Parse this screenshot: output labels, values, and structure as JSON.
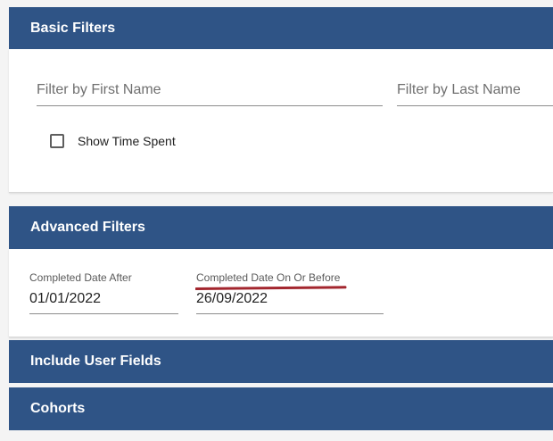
{
  "basic_filters": {
    "title": "Basic Filters",
    "first_name_placeholder": "Filter by First Name",
    "last_name_placeholder": "Filter by Last Name",
    "show_time_spent_label": "Show Time Spent",
    "show_time_spent_checked": false
  },
  "advanced_filters": {
    "title": "Advanced Filters",
    "completed_after_label": "Completed Date After",
    "completed_after_value": "01/01/2022",
    "completed_on_or_before_label": "Completed Date On Or Before",
    "completed_on_or_before_value": "26/09/2022"
  },
  "include_user_fields": {
    "title": "Include User Fields"
  },
  "cohorts": {
    "title": "Cohorts"
  },
  "colors": {
    "header_bg": "#2f5486",
    "annotation_red": "#a3262e"
  }
}
